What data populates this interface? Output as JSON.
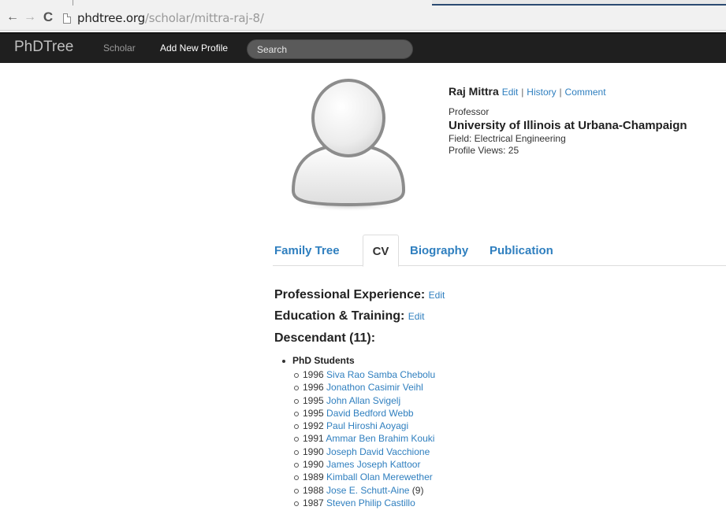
{
  "browser": {
    "url_host": "phdtree.org",
    "url_path": "/scholar/mittra-raj-8/",
    "back_icon": "←",
    "forward_icon": "→",
    "reload_icon": "C"
  },
  "navbar": {
    "brand": "PhDTree",
    "scholar": "Scholar",
    "add_profile": "Add New Profile",
    "search_placeholder": "Search"
  },
  "profile": {
    "name": "Raj Mittra",
    "edit": "Edit",
    "history": "History",
    "comment": "Comment",
    "separator": "|",
    "role": "Professor",
    "institution": "University of Illinois at Urbana-Champaign",
    "field": "Field: Electrical Engineering",
    "views": "Profile Views: 25"
  },
  "tabs": {
    "family_tree": "Family Tree",
    "cv": "CV",
    "biography": "Biography",
    "publication": "Publication"
  },
  "cv": {
    "professional": "Professional Experience:",
    "education": "Education & Training:",
    "edit": "Edit",
    "descendant": "Descendant (11):",
    "group": "PhD Students",
    "students": [
      {
        "year": "1996",
        "name": "Siva Rao Samba Chebolu",
        "extra": ""
      },
      {
        "year": "1996",
        "name": "Jonathon Casimir Veihl",
        "extra": ""
      },
      {
        "year": "1995",
        "name": "John Allan Svigelj",
        "extra": ""
      },
      {
        "year": "1995",
        "name": "David Bedford Webb",
        "extra": ""
      },
      {
        "year": "1992",
        "name": "Paul Hiroshi Aoyagi",
        "extra": ""
      },
      {
        "year": "1991",
        "name": "Ammar Ben Brahim Kouki",
        "extra": ""
      },
      {
        "year": "1990",
        "name": "Joseph David Vacchione",
        "extra": ""
      },
      {
        "year": "1990",
        "name": "James Joseph Kattoor",
        "extra": ""
      },
      {
        "year": "1989",
        "name": "Kimball Olan Merewether",
        "extra": ""
      },
      {
        "year": "1988",
        "name": "Jose E. Schutt-Aine",
        "extra": "(9)"
      },
      {
        "year": "1987",
        "name": "Steven Philip Castillo",
        "extra": ""
      }
    ]
  },
  "colors": {
    "link": "#2f7fbf",
    "navbar_bg": "#1f1f1f"
  }
}
